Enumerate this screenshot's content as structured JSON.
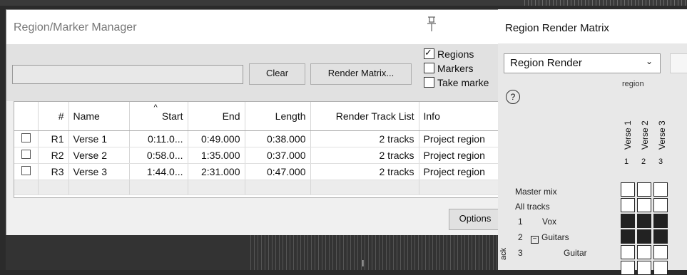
{
  "manager": {
    "title": "Region/Marker Manager",
    "filter_value": "",
    "clear_label": "Clear",
    "render_matrix_label": "Render Matrix...",
    "checkboxes": [
      {
        "label": "Regions",
        "checked": true
      },
      {
        "label": "Markers",
        "checked": false
      },
      {
        "label": "Take marke",
        "checked": false
      }
    ],
    "columns": [
      "",
      "#",
      "Name",
      "Start",
      "End",
      "Length",
      "Render Track List",
      "Info"
    ],
    "rows": [
      {
        "id": "R1",
        "name": "Verse 1",
        "start": "0:11.0...",
        "end": "0:49.000",
        "length": "0:38.000",
        "tracks": "2 tracks",
        "info": "Project region"
      },
      {
        "id": "R2",
        "name": "Verse 2",
        "start": "0:58.0...",
        "end": "1:35.000",
        "length": "0:37.000",
        "tracks": "2 tracks",
        "info": "Project region"
      },
      {
        "id": "R3",
        "name": "Verse 3",
        "start": "1:44.0...",
        "end": "2:31.000",
        "length": "0:47.000",
        "tracks": "2 tracks",
        "info": "Project region"
      }
    ],
    "options_label": "Options"
  },
  "matrix": {
    "title": "Region Render Matrix",
    "mode_value": "Region Render",
    "region_label": "region",
    "help_glyph": "?",
    "region_cols": [
      {
        "name": "Verse 1",
        "num": "1"
      },
      {
        "name": "Verse 2",
        "num": "2"
      },
      {
        "name": "Verse 3",
        "num": "3"
      }
    ],
    "rows": [
      {
        "num": "",
        "label": "Master mix",
        "cells": [
          false,
          false,
          false
        ]
      },
      {
        "num": "",
        "label": "All tracks",
        "cells": [
          false,
          false,
          false
        ]
      },
      {
        "num": "1",
        "label": "Vox",
        "cells": [
          true,
          true,
          true
        ]
      },
      {
        "num": "2",
        "label": "Guitars",
        "cells": [
          true,
          true,
          true
        ],
        "folder": true
      },
      {
        "num": "3",
        "label": "Guitar",
        "cells": [
          false,
          false,
          false
        ]
      }
    ],
    "track_axis_label": "ack"
  }
}
